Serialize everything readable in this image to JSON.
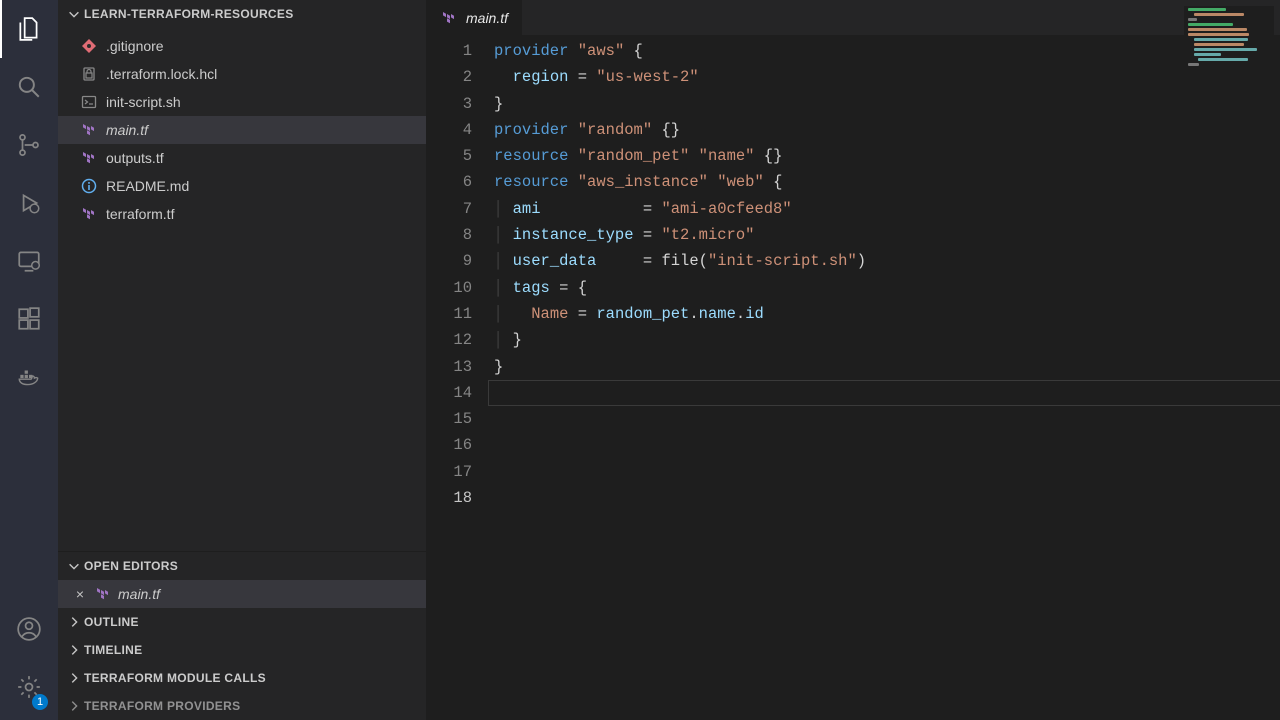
{
  "activity": {
    "settings_badge": "1"
  },
  "sidebar": {
    "project_name": "LEARN-TERRAFORM-RESOURCES",
    "files": [
      {
        "label": ".gitignore",
        "icon": "gitignore"
      },
      {
        "label": ".terraform.lock.hcl",
        "icon": "lock"
      },
      {
        "label": "init-script.sh",
        "icon": "shell"
      },
      {
        "label": "main.tf",
        "icon": "tf",
        "selected": true
      },
      {
        "label": "outputs.tf",
        "icon": "tf"
      },
      {
        "label": "README.md",
        "icon": "readme"
      },
      {
        "label": "terraform.tf",
        "icon": "tf"
      }
    ],
    "panels": {
      "open_editors": {
        "title": "OPEN EDITORS",
        "items": [
          {
            "label": "main.tf",
            "icon": "tf"
          }
        ]
      },
      "outline": "OUTLINE",
      "timeline": "TIMELINE",
      "tf_module_calls": "TERRAFORM MODULE CALLS",
      "tf_providers": "TERRAFORM PROVIDERS"
    }
  },
  "editor": {
    "tab_label": "main.tf",
    "lines": [
      {
        "n": 1,
        "seg": [
          {
            "c": "kw1",
            "t": "provider"
          },
          {
            "c": "func",
            "t": " "
          },
          {
            "c": "str",
            "t": "\"aws\""
          },
          {
            "c": "func",
            "t": " {"
          }
        ]
      },
      {
        "n": 2,
        "seg": [
          {
            "c": "func",
            "t": "  "
          },
          {
            "c": "attr",
            "t": "region"
          },
          {
            "c": "func",
            "t": " = "
          },
          {
            "c": "str",
            "t": "\"us-west-2\""
          }
        ]
      },
      {
        "n": 3,
        "seg": [
          {
            "c": "func",
            "t": "}"
          }
        ]
      },
      {
        "n": 4,
        "seg": [
          {
            "c": "func",
            "t": ""
          }
        ]
      },
      {
        "n": 5,
        "seg": [
          {
            "c": "kw1",
            "t": "provider"
          },
          {
            "c": "func",
            "t": " "
          },
          {
            "c": "str",
            "t": "\"random\""
          },
          {
            "c": "func",
            "t": " {}"
          }
        ]
      },
      {
        "n": 6,
        "seg": [
          {
            "c": "func",
            "t": ""
          }
        ]
      },
      {
        "n": 7,
        "seg": [
          {
            "c": "kw1",
            "t": "resource"
          },
          {
            "c": "func",
            "t": " "
          },
          {
            "c": "str",
            "t": "\"random_pet\""
          },
          {
            "c": "func",
            "t": " "
          },
          {
            "c": "str",
            "t": "\"name\""
          },
          {
            "c": "func",
            "t": " {}"
          }
        ]
      },
      {
        "n": 8,
        "seg": [
          {
            "c": "func",
            "t": ""
          }
        ]
      },
      {
        "n": 9,
        "seg": [
          {
            "c": "kw1",
            "t": "resource"
          },
          {
            "c": "func",
            "t": " "
          },
          {
            "c": "str",
            "t": "\"aws_instance\""
          },
          {
            "c": "func",
            "t": " "
          },
          {
            "c": "str",
            "t": "\"web\""
          },
          {
            "c": "func",
            "t": " {"
          }
        ]
      },
      {
        "n": 10,
        "seg": [
          {
            "c": "func",
            "t": "  "
          },
          {
            "c": "attr",
            "t": "ami"
          },
          {
            "c": "func",
            "t": "           = "
          },
          {
            "c": "str",
            "t": "\"ami-a0cfeed8\""
          }
        ]
      },
      {
        "n": 11,
        "seg": [
          {
            "c": "func",
            "t": "  "
          },
          {
            "c": "attr",
            "t": "instance_type"
          },
          {
            "c": "func",
            "t": " = "
          },
          {
            "c": "str",
            "t": "\"t2.micro\""
          }
        ]
      },
      {
        "n": 12,
        "seg": [
          {
            "c": "func",
            "t": "  "
          },
          {
            "c": "attr",
            "t": "user_data"
          },
          {
            "c": "func",
            "t": "     = file("
          },
          {
            "c": "str",
            "t": "\"init-script.sh\""
          },
          {
            "c": "func",
            "t": ")"
          }
        ]
      },
      {
        "n": 13,
        "seg": [
          {
            "c": "func",
            "t": ""
          }
        ]
      },
      {
        "n": 14,
        "seg": [
          {
            "c": "func",
            "t": "  "
          },
          {
            "c": "attr",
            "t": "tags"
          },
          {
            "c": "func",
            "t": " = {"
          }
        ]
      },
      {
        "n": 15,
        "seg": [
          {
            "c": "func",
            "t": "    "
          },
          {
            "c": "name2",
            "t": "Name"
          },
          {
            "c": "func",
            "t": " = "
          },
          {
            "c": "attr",
            "t": "random_pet"
          },
          {
            "c": "func",
            "t": "."
          },
          {
            "c": "attr",
            "t": "name"
          },
          {
            "c": "func",
            "t": "."
          },
          {
            "c": "attr",
            "t": "id"
          }
        ]
      },
      {
        "n": 16,
        "seg": [
          {
            "c": "func",
            "t": "  }"
          }
        ]
      },
      {
        "n": 17,
        "seg": [
          {
            "c": "func",
            "t": "}"
          }
        ]
      },
      {
        "n": 18,
        "seg": [
          {
            "c": "func",
            "t": ""
          }
        ],
        "active": true
      }
    ]
  }
}
